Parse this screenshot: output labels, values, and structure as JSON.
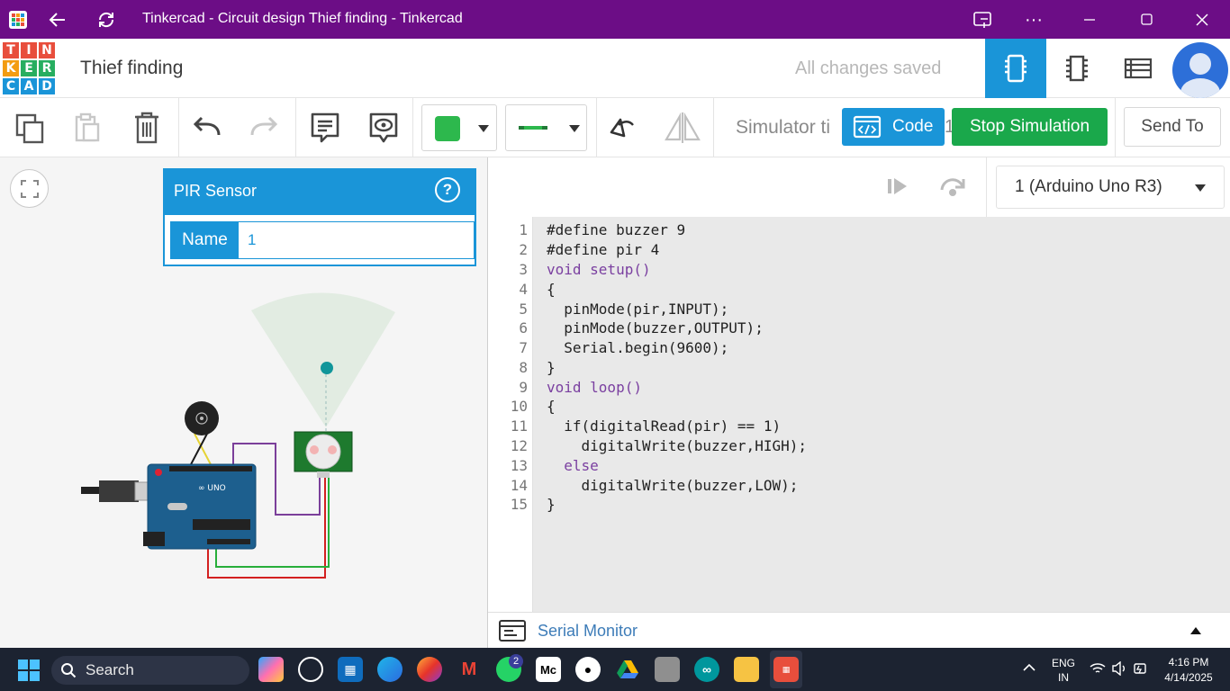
{
  "window": {
    "title": "Tinkercad - Circuit design Thief finding - Tinkercad"
  },
  "header": {
    "logo_letters": [
      "T",
      "I",
      "N",
      "K",
      "E",
      "R",
      "C",
      "A",
      "D"
    ],
    "project_name": "Thief finding",
    "save_status": "All changes saved"
  },
  "toolbar": {
    "fill_color": "#2db84d",
    "simulator_time": "Simulator ti",
    "code_label": "Code",
    "code_hidden_char": "1",
    "stop_label": "Stop Simulation",
    "send_label": "Send To"
  },
  "inspector": {
    "title": "PIR Sensor",
    "help": "?",
    "name_label": "Name",
    "name_value": "1"
  },
  "code": {
    "board": "1 (Arduino Uno R3)",
    "line_numbers": [
      "1",
      "2",
      "3",
      "4",
      "5",
      "6",
      "7",
      "8",
      "9",
      "10",
      "11",
      "12",
      "13",
      "14",
      "15"
    ],
    "lines": [
      "#define buzzer 9",
      "#define pir 4",
      "void setup()",
      "{",
      "  pinMode(pir,INPUT);",
      "  pinMode(buzzer,OUTPUT);",
      "  Serial.begin(9600);",
      "}",
      "void loop()",
      "{",
      "  if(digitalRead(pir) == 1)",
      "    digitalWrite(buzzer,HIGH);",
      "  else",
      "    digitalWrite(buzzer,LOW);",
      "}"
    ],
    "serial_monitor": "Serial Monitor"
  },
  "taskbar": {
    "search": "Search",
    "whatsapp_badge": "2",
    "lang_top": "ENG",
    "lang_bottom": "IN",
    "time": "4:16 PM",
    "date": "4/14/2025"
  },
  "colors": {
    "titlebar": "#6c0d86",
    "accent": "#1a95d8",
    "stop": "#1aa84b"
  }
}
